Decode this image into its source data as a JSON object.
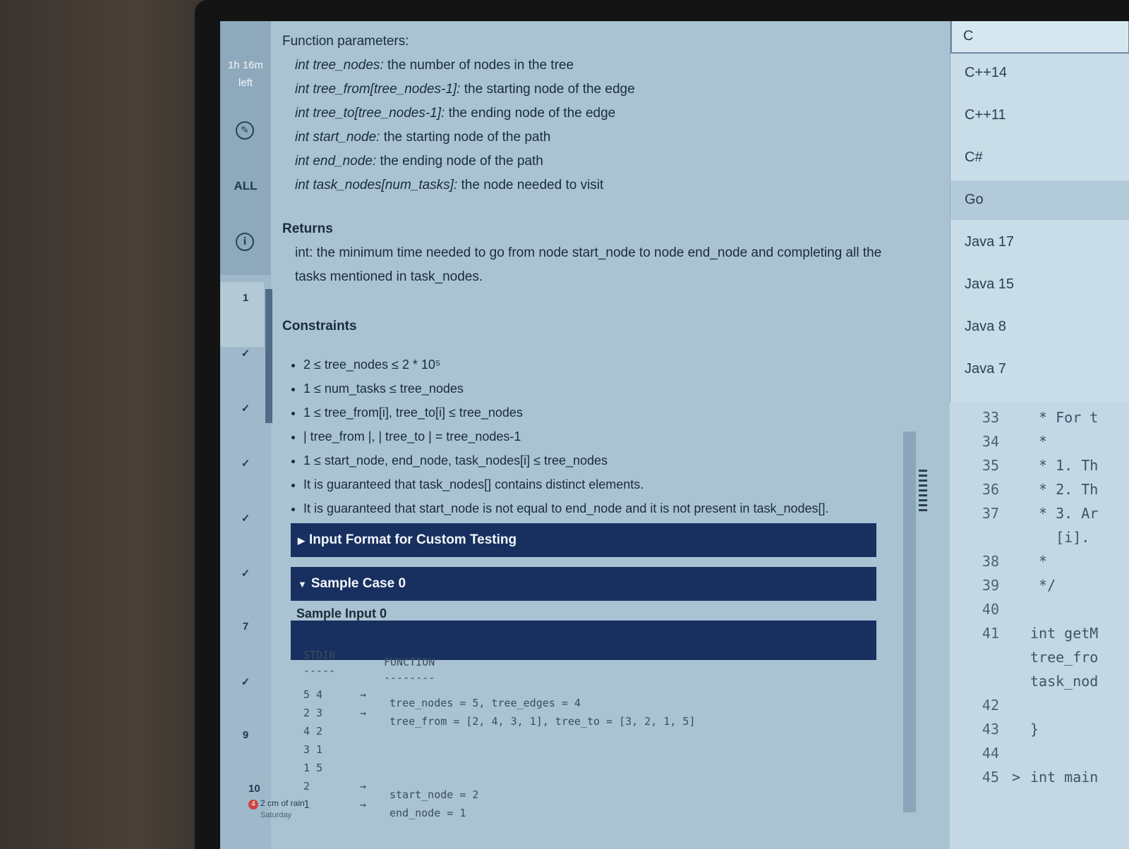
{
  "timer": {
    "line1": "1h 16m",
    "line2": "left"
  },
  "rail": {
    "all_label": "ALL",
    "items": [
      "1",
      "✓",
      "✓",
      "✓",
      "✓",
      "✓",
      "7",
      "✓",
      "9",
      "10"
    ]
  },
  "weather": {
    "text": "2 cm of rain",
    "sub": "Saturday",
    "badge": "4"
  },
  "problem": {
    "params_title": "Function parameters:",
    "params": [
      {
        "name": "int tree_nodes:",
        "desc": " the number of nodes in the tree"
      },
      {
        "name": "int tree_from[tree_nodes-1]:",
        "desc": " the starting node of the edge"
      },
      {
        "name": "int tree_to[tree_nodes-1]:",
        "desc": " the ending node of the edge"
      },
      {
        "name": "int start_node:",
        "desc": " the starting node of the path"
      },
      {
        "name": "int end_node:",
        "desc": " the ending node of the path"
      },
      {
        "name": "int task_nodes[num_tasks]:",
        "desc": " the node needed to visit"
      }
    ],
    "returns_title": "Returns",
    "returns_text": "int: the minimum time needed to go from node start_node to node end_node and completing all the tasks mentioned in task_nodes.",
    "constraints_title": "Constraints",
    "constraints": [
      "2 ≤ tree_nodes ≤ 2 * 10⁵",
      "1 ≤ num_tasks ≤ tree_nodes",
      "1 ≤ tree_from[i], tree_to[i] ≤ tree_nodes",
      "| tree_from |, | tree_to | = tree_nodes-1",
      "1 ≤ start_node, end_node, task_nodes[i] ≤ tree_nodes",
      "It is guaranteed that task_nodes[] contains distinct elements.",
      "It is guaranteed that start_node is not equal to end_node and it is not present in task_nodes[]."
    ]
  },
  "sections": {
    "input_format": "Input Format for Custom Testing",
    "sample_case": "Sample Case 0",
    "sample_input": "Sample Input 0"
  },
  "sample": {
    "stdin_header": "STDIN",
    "stdin_rule": "-----",
    "function_header": "FUNCTION",
    "function_rule": "--------",
    "stdin_lines": "5 4\n2 3\n4 2\n3 1\n1 5\n2\n1",
    "arrows": "→\n→\n\n\n\n→\n→",
    "function_lines": "tree_nodes = 5, tree_edges = 4\ntree_from = [2, 4, 3, 1], tree_to = [3, 2, 1, 5]\n\n\n\nstart_node = 2\nend_node = 1"
  },
  "language_dropdown": {
    "search_value": "C",
    "options": [
      "C++14",
      "C++11",
      "C#",
      "Go",
      "Java 17",
      "Java 15",
      "Java 8",
      "Java 7"
    ],
    "selected": "Go"
  },
  "editor": {
    "lines": [
      {
        "n": "33",
        "code": " * For t"
      },
      {
        "n": "34",
        "code": " *"
      },
      {
        "n": "35",
        "code": " * 1. Th"
      },
      {
        "n": "36",
        "code": " * 2. Th"
      },
      {
        "n": "37",
        "code": " * 3. Ar"
      },
      {
        "n": "",
        "code": "   [i]."
      },
      {
        "n": "38",
        "code": " *"
      },
      {
        "n": "39",
        "code": " */"
      },
      {
        "n": "40",
        "code": ""
      },
      {
        "n": "41",
        "code": "int getM"
      },
      {
        "n": "",
        "code": "tree_fro"
      },
      {
        "n": "",
        "code": "task_nod"
      },
      {
        "n": "42",
        "code": ""
      },
      {
        "n": "43",
        "code": "}"
      },
      {
        "n": "44",
        "code": ""
      },
      {
        "n": "45",
        "code": "int main"
      }
    ],
    "fold_glyph": ">"
  }
}
